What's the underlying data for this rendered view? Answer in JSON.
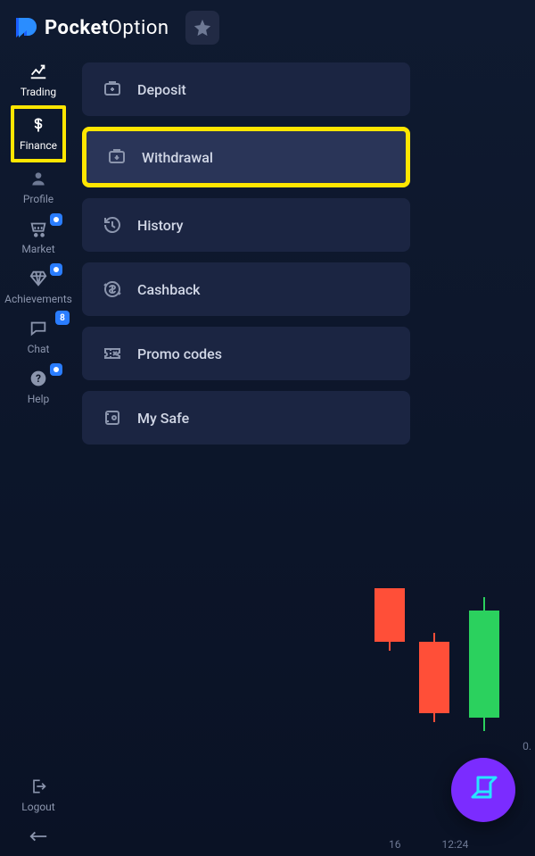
{
  "brand": {
    "bold": "Pocket",
    "thin": "Option"
  },
  "sidebar": {
    "items": [
      {
        "label": "Trading"
      },
      {
        "label": "Finance"
      },
      {
        "label": "Profile"
      },
      {
        "label": "Market"
      },
      {
        "label": "Achievements"
      },
      {
        "label": "Chat",
        "badge": "8"
      },
      {
        "label": "Help"
      }
    ],
    "logout": "Logout"
  },
  "submenu": {
    "items": [
      {
        "label": "Deposit"
      },
      {
        "label": "Withdrawal"
      },
      {
        "label": "History"
      },
      {
        "label": "Cashback"
      },
      {
        "label": "Promo codes"
      },
      {
        "label": "My Safe"
      }
    ]
  },
  "chart": {
    "xticks": [
      "16",
      "12:24"
    ],
    "ytick": "0."
  }
}
